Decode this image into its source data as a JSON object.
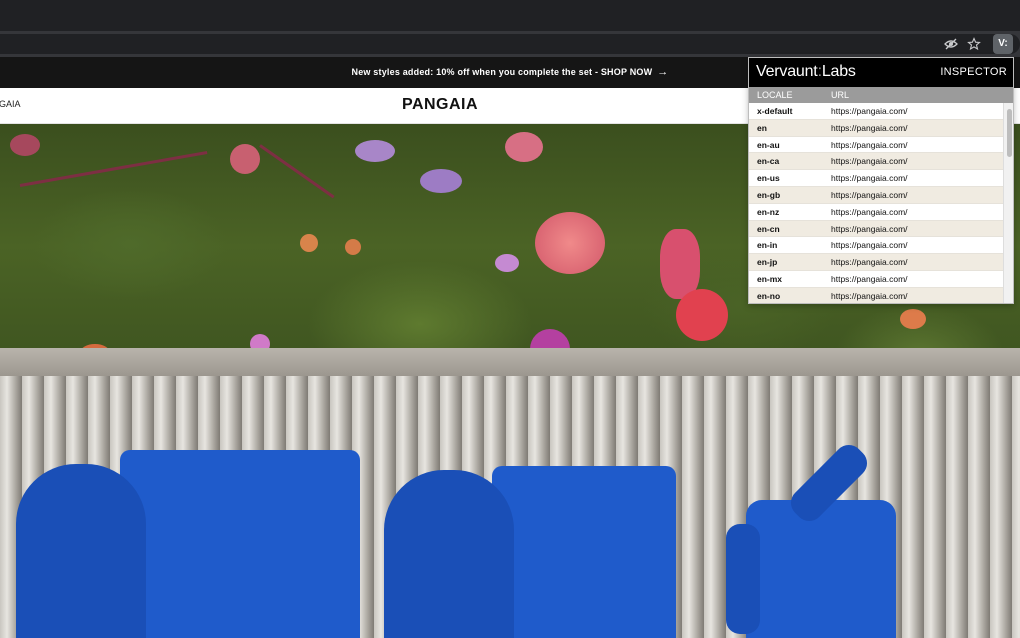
{
  "browser": {
    "icons": [
      "eye-off-icon",
      "star-icon",
      "extension-icon"
    ],
    "extension_label": "V:"
  },
  "promo": {
    "text": "New styles added: 10% off when you complete the set - SHOP NOW",
    "arrow": "→"
  },
  "header": {
    "left_nav": "GAIA",
    "logo": "PANGAIA"
  },
  "inspector": {
    "brand_main": "Vervaunt",
    "brand_sep": ":",
    "brand_sub": "Labs",
    "tab": "INSPECTOR",
    "columns": {
      "locale": "LOCALE",
      "url": "URL"
    },
    "rows": [
      {
        "locale": "x-default",
        "url": "https://pangaia.com/"
      },
      {
        "locale": "en",
        "url": "https://pangaia.com/"
      },
      {
        "locale": "en-au",
        "url": "https://pangaia.com/"
      },
      {
        "locale": "en-ca",
        "url": "https://pangaia.com/"
      },
      {
        "locale": "en-us",
        "url": "https://pangaia.com/"
      },
      {
        "locale": "en-gb",
        "url": "https://pangaia.com/"
      },
      {
        "locale": "en-nz",
        "url": "https://pangaia.com/"
      },
      {
        "locale": "en-cn",
        "url": "https://pangaia.com/"
      },
      {
        "locale": "en-in",
        "url": "https://pangaia.com/"
      },
      {
        "locale": "en-jp",
        "url": "https://pangaia.com/"
      },
      {
        "locale": "en-mx",
        "url": "https://pangaia.com/"
      },
      {
        "locale": "en-no",
        "url": "https://pangaia.com/"
      }
    ]
  },
  "colors": {
    "promo_bg": "#151515",
    "garment_blue": "#1f5bcb",
    "row_alt": "#f0ebe1"
  }
}
